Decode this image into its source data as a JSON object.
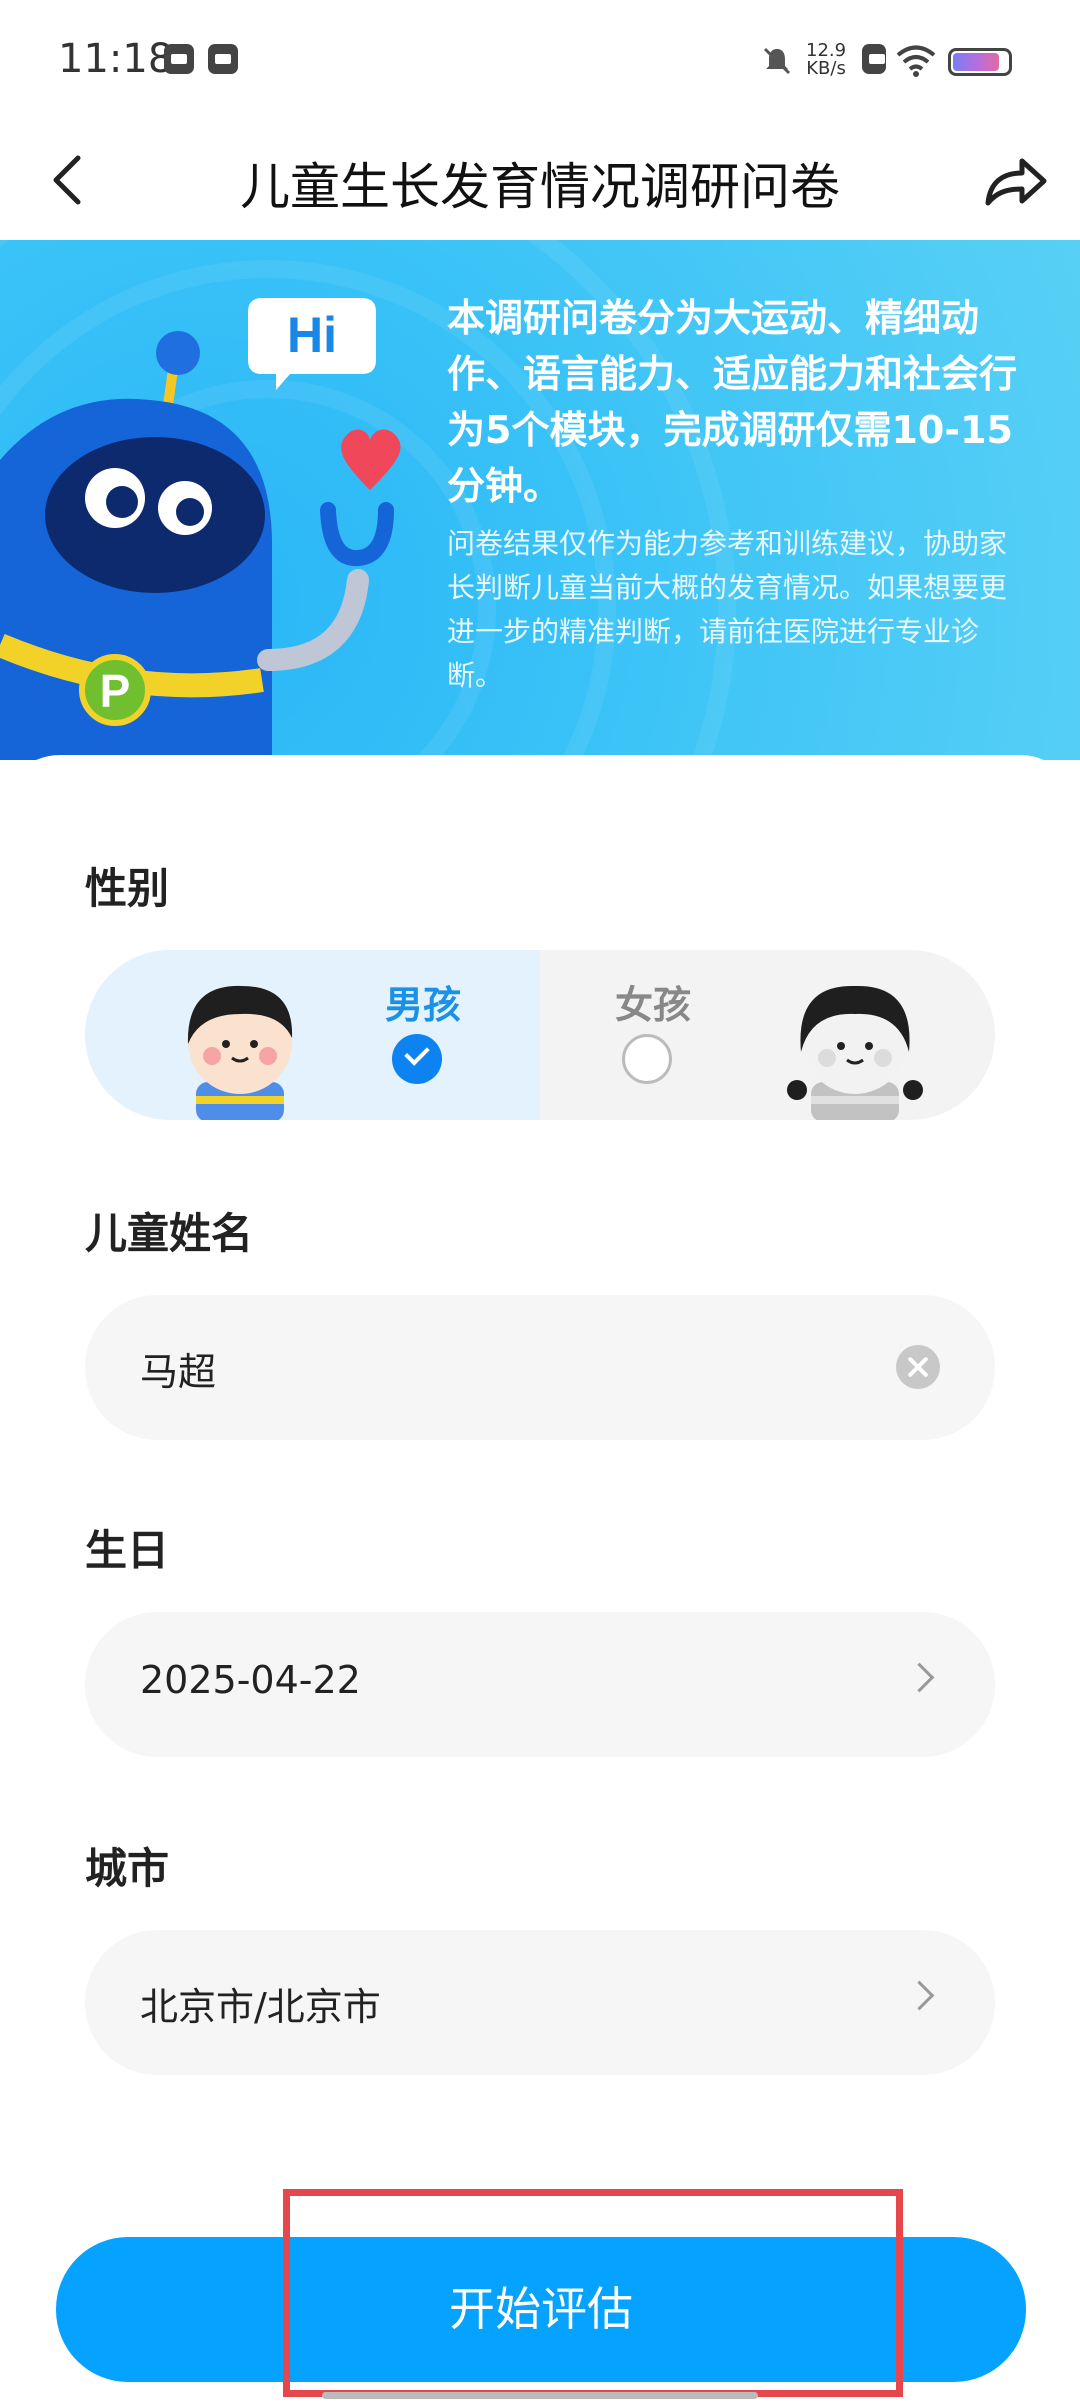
{
  "status_bar": {
    "time": "11:18",
    "net_speed_value": "12.9",
    "net_speed_unit": "KB/s"
  },
  "nav": {
    "title": "儿童生长发育情况调研问卷"
  },
  "banner": {
    "bubble_text": "Hi",
    "badge_letter": "P",
    "title": "本调研问卷分为大运动、精细动作、语言能力、适应能力和社会行为5个模块，完成调研仅需10-15分钟。",
    "description": "问卷结果仅作为能力参考和训练建议，协助家长判断儿童当前大概的发育情况。如果想要更进一步的精准判断，请前往医院进行专业诊断。"
  },
  "form": {
    "gender": {
      "label": "性别",
      "male": "男孩",
      "female": "女孩",
      "selected": "男孩"
    },
    "name": {
      "label": "儿童姓名",
      "value": "马超"
    },
    "birthday": {
      "label": "生日",
      "value": "2025-04-22"
    },
    "city": {
      "label": "城市",
      "value": "北京市/北京市"
    }
  },
  "actions": {
    "start_label": "开始评估"
  },
  "colors": {
    "primary": "#05a3ff",
    "banner": "#39c2f7",
    "highlight": "#e5474d",
    "checked": "#0d83f2"
  }
}
